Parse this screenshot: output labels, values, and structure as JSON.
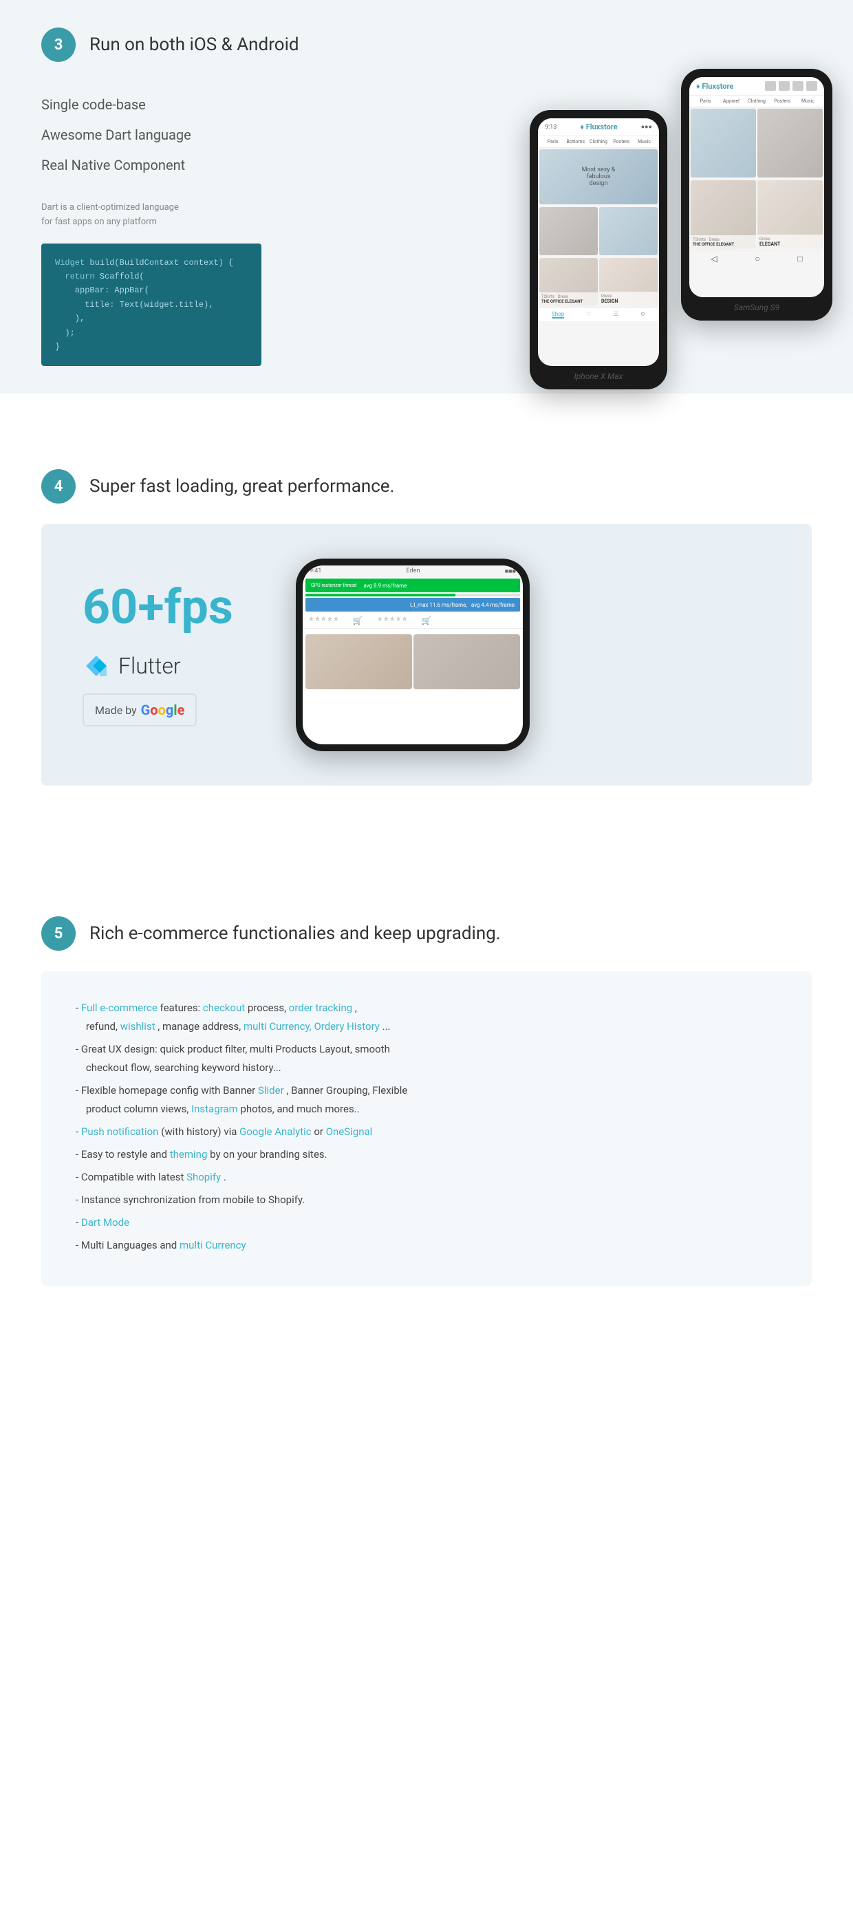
{
  "section3": {
    "number": "3",
    "title": "Run on both iOS & Android",
    "features": [
      "Single code-base",
      "Awesome Dart language",
      "Real Native Component"
    ],
    "description": "Dart is a client-optimized language\nfor fast apps on any platform",
    "code": [
      "Widget build(BuildContaxt context) {",
      "  return Scaffold(",
      "    appBar: AppBar(",
      "      title: Text(widget.title),",
      "    ),",
      "  );",
      "}"
    ],
    "iphone_label": "Iphone X Max",
    "android_label": "SamSung S9",
    "app_bar_title": "Fluxstore",
    "app_categories": [
      "Paris",
      "Bottoms",
      "Clothing",
      "Posters",
      "Music"
    ]
  },
  "section4": {
    "number": "4",
    "title": "Super fast loading, great performance.",
    "fps_label": "60+fps",
    "flutter_label": "Flutter",
    "google_label": "Made by Google",
    "perf_bar1": "avg 8.9 ms/frame",
    "perf_bar2": "avg 4.4 ms/frame",
    "perf_bar1_left": "UI_max 11.6 ms/frame,",
    "status_bar_left": "9:41",
    "status_bar_right": "Eden"
  },
  "section5": {
    "number": "5",
    "title": "Rich e-commerce functionalies and keep upgrading.",
    "items": [
      {
        "text": "Full e-commerce",
        "link": true,
        "parts": [
          {
            "text": "- ",
            "type": "normal"
          },
          {
            "text": "Full e-commerce",
            "type": "link"
          },
          {
            "text": " features: ",
            "type": "normal"
          },
          {
            "text": "checkout",
            "type": "link"
          },
          {
            "text": " process, ",
            "type": "normal"
          },
          {
            "text": "order tracking",
            "type": "link"
          },
          {
            "text": ", refund, ",
            "type": "normal"
          },
          {
            "text": "wishlist",
            "type": "link"
          },
          {
            "text": ", manage address, ",
            "type": "normal"
          },
          {
            "text": "multi Currency, Ordery History",
            "type": "link"
          },
          {
            "text": "...",
            "type": "normal"
          }
        ]
      },
      {
        "parts": [
          {
            "text": "- Great UX design: quick product filter, multi Products Layout, smooth checkout flow, searching keyword history...",
            "type": "normal"
          }
        ]
      },
      {
        "parts": [
          {
            "text": "- Flexible homepage config with Banner ",
            "type": "normal"
          },
          {
            "text": "Slider",
            "type": "link"
          },
          {
            "text": ", Banner Grouping, Flexible product column views, ",
            "type": "normal"
          },
          {
            "text": "Instagram",
            "type": "link"
          },
          {
            "text": " photos, and much mores..",
            "type": "normal"
          }
        ]
      },
      {
        "parts": [
          {
            "text": "- ",
            "type": "normal"
          },
          {
            "text": "Push notification",
            "type": "link"
          },
          {
            "text": " (with history) via ",
            "type": "normal"
          },
          {
            "text": "Google Analytic",
            "type": "link"
          },
          {
            "text": " or ",
            "type": "normal"
          },
          {
            "text": "OneSignal",
            "type": "link"
          }
        ]
      },
      {
        "parts": [
          {
            "text": "- Easy to restyle and ",
            "type": "normal"
          },
          {
            "text": "theming",
            "type": "link"
          },
          {
            "text": " by on your branding sites.",
            "type": "normal"
          }
        ]
      },
      {
        "parts": [
          {
            "text": "- Compatible with latest ",
            "type": "normal"
          },
          {
            "text": "Shopify",
            "type": "link"
          },
          {
            "text": ".",
            "type": "normal"
          }
        ]
      },
      {
        "parts": [
          {
            "text": "- Instance synchronization from mobile to Shopify.",
            "type": "normal"
          }
        ]
      },
      {
        "parts": [
          {
            "text": "- ",
            "type": "normal"
          },
          {
            "text": "Dart Mode",
            "type": "link"
          }
        ]
      },
      {
        "parts": [
          {
            "text": "- Multi Languages and ",
            "type": "normal"
          },
          {
            "text": "multi Currency",
            "type": "link"
          }
        ]
      }
    ]
  }
}
